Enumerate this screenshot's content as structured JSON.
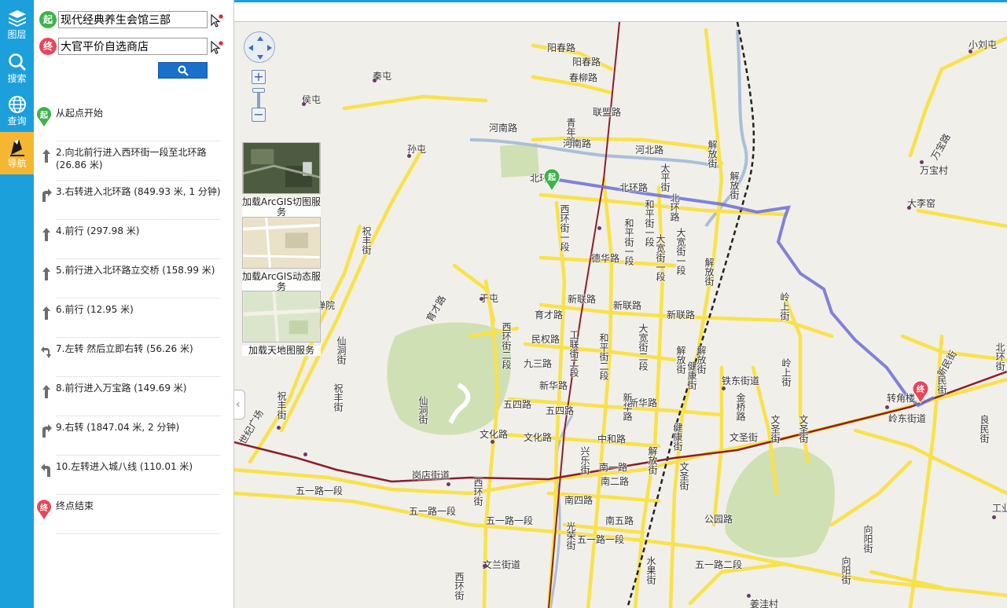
{
  "rail": {
    "items": [
      {
        "label": "图层",
        "icon": "layers-icon"
      },
      {
        "label": "搜索",
        "icon": "search-icon"
      },
      {
        "label": "查询",
        "icon": "globe-icon"
      },
      {
        "label": "导航",
        "icon": "navigation-icon"
      }
    ],
    "active": 3
  },
  "route": {
    "start_badge": "起",
    "end_badge": "终",
    "start_value": "现代经典养生会馆三部",
    "end_value": "大官平价自选商店",
    "search_icon": "search-icon"
  },
  "steps": {
    "start_text": "从起点开始",
    "end_text": "终点结束",
    "items": [
      {
        "icon": "straight-arrow-icon",
        "text": "2.向北前行进入西环街一段至北环路",
        "detail": "(26.86 米)"
      },
      {
        "icon": "turn-right-arrow-icon",
        "text": "3.右转进入北环路",
        "detail": "(849.93 米, 1 分钟)"
      },
      {
        "icon": "straight-arrow-icon",
        "text": "4.前行",
        "detail": "(297.98 米)"
      },
      {
        "icon": "straight-arrow-icon",
        "text": "5.前行进入北环路立交桥",
        "detail": "(158.99 米)"
      },
      {
        "icon": "straight-arrow-icon",
        "text": "6.前行",
        "detail": "(12.95 米)"
      },
      {
        "icon": "left-then-right-arrow-icon",
        "text": "7.左转 然后立即右转",
        "detail": "(56.26 米)"
      },
      {
        "icon": "straight-arrow-icon",
        "text": "8.前行进入万宝路",
        "detail": "(149.69 米)"
      },
      {
        "icon": "turn-right-arrow-icon",
        "text": "9.右转",
        "detail": "(1847.04 米, 2 分钟)"
      },
      {
        "icon": "turn-left-arrow-icon",
        "text": "10.左转进入城八线",
        "detail": "(110.01 米)"
      }
    ]
  },
  "basemaps": [
    {
      "label": "加载ArcGIS切图服务"
    },
    {
      "label": "加载ArcGIS动态服务"
    },
    {
      "label": "加载天地图服务"
    }
  ],
  "map": {
    "labels": {
      "l1": "阳春路",
      "l2": "阳春路",
      "l3": "春柳路",
      "l4": "联盟路",
      "l5": "青年路",
      "l6": "河南路",
      "l7": "河南路",
      "l8": "河北路",
      "l9": "北环路",
      "l10": "北环路",
      "l11": "秦屯",
      "l12": "侯屯",
      "l13": "孙屯",
      "l14": "小刘屯",
      "l15": "万宝路",
      "l16": "万宝村",
      "l17": "大李窑",
      "l18": "解放街",
      "l19": "西环街一段",
      "l20": "和平街一段",
      "l21": "德华路",
      "l22": "大宽街一段",
      "l23": "解放街",
      "l24": "于屯",
      "l25": "育才路",
      "l26": "育才路",
      "l27": "新联路",
      "l28": "新联路",
      "l29": "新联路",
      "l30": "民权路",
      "l31": "九三路",
      "l32": "新华路",
      "l33": "五四路",
      "l34": "五四路",
      "l35": "新华路",
      "l36": "文化路",
      "l37": "文化路",
      "l38": "中和路",
      "l39": "南一路",
      "l40": "南二路",
      "l41": "南四路",
      "l42": "南五路",
      "l43": "世纪广场",
      "l44": "岗店街道",
      "l45": "五一路一段",
      "l46": "五一路一段",
      "l47": "五一路一段",
      "l48": "五一路一段",
      "l49": "五一路二段",
      "l50": "文兰街道",
      "l51": "铁东街道",
      "l52": "金桥路",
      "l53": "文圣街",
      "l54": "公园路",
      "l55": "岭东街道",
      "l56": "转角楼",
      "l57": "岭上街",
      "l58": "民街",
      "l59": "仙洞街",
      "l60": "仙洞街",
      "l61": "祝丰街",
      "l62": "祝丰街",
      "l63": "祝丰街",
      "l64": "禅院",
      "l65": "姜洼村",
      "l66": "工业",
      "l67": "向阳街",
      "l68": "向阳街",
      "l69": "水果街",
      "l70": "西环街",
      "l71": "光荣街",
      "l72": "兴乐街",
      "l73": "健康街",
      "l74": "解放街",
      "l75": "文圣街",
      "l76": "西环街二段",
      "l77": "工联街二段",
      "l78": "和平街二段",
      "l79": "大宽街二段",
      "l80": "健康街",
      "l81": "文圣街",
      "l82": "新华路",
      "l83": "北环",
      "l84": "新民街",
      "l85": "西环街",
      "l86": "和平街一段",
      "l87": "大宽街一段",
      "l88": "良民街",
      "l89": "岭上街",
      "l90": "解放街",
      "l91": "解放街",
      "l92": "解放街",
      "l93": "太平街",
      "l94": "文圣街",
      "l95": "北环街"
    }
  },
  "colors": {
    "rail": "#1ba0dc",
    "rail_active": "#f5b731",
    "start": "#3cb44b",
    "end": "#e8465b",
    "route": "#6b6fd4",
    "road": "#f9e14a",
    "search_button": "#1a70c8"
  }
}
